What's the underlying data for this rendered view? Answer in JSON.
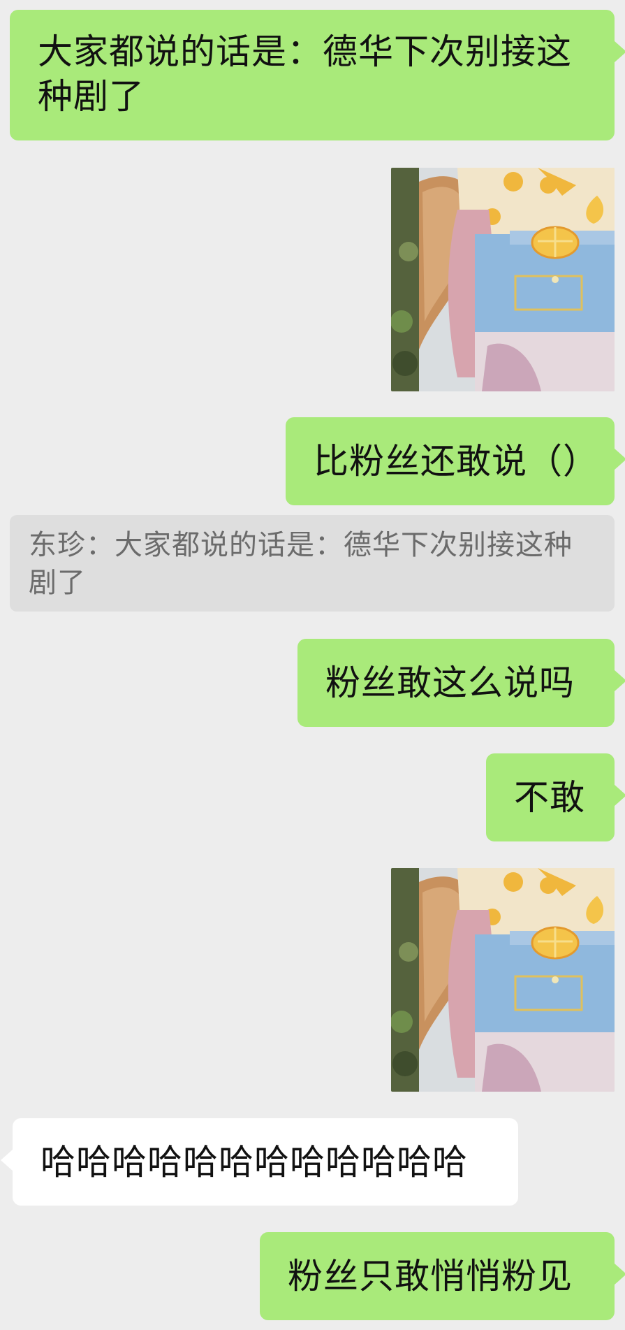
{
  "messages": {
    "m1": "大家都说的话是：德华下次别接这种剧了",
    "m2": "比粉丝还敢说（）",
    "quote": "东珍：大家都说的话是：德华下次别接这种剧了",
    "m3": "粉丝敢这么说吗",
    "m4": "不敢",
    "m5": "哈哈哈哈哈哈哈哈哈哈哈哈",
    "m6": "粉丝只敢悄悄粉见"
  },
  "stickers": {
    "icon": "squirrel-plush-sticker"
  },
  "colors": {
    "background": "#ededed",
    "outgoing_bubble": "#a9ea7a",
    "incoming_bubble": "#ffffff",
    "quote_background": "#dedede"
  }
}
